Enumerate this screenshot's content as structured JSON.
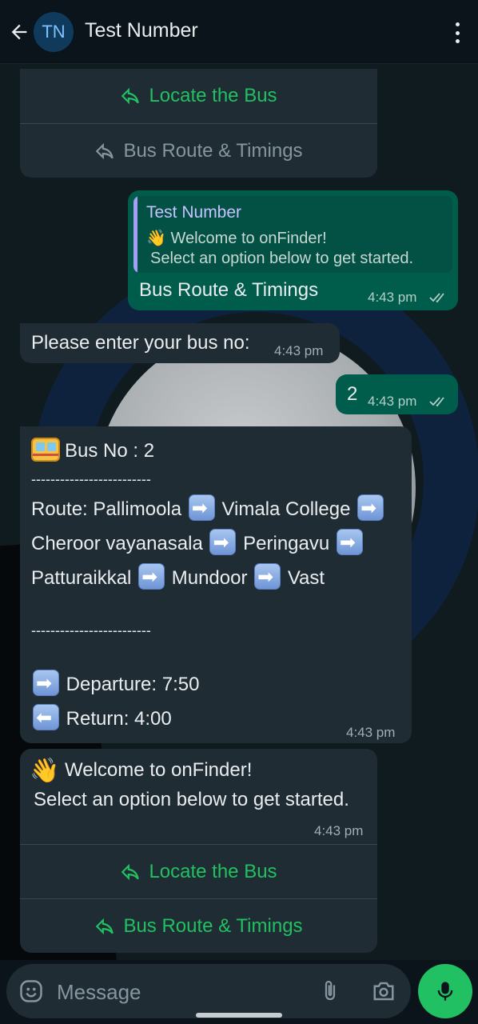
{
  "header": {
    "title": "Test Number",
    "avatar_initials": "TN"
  },
  "top_card": {
    "btn1": "Locate the Bus",
    "btn2": "Bus Route & Timings"
  },
  "reply_out": {
    "quote_author": "Test Number",
    "quote_line1": "👋 Welcome to onFinder!",
    "quote_line2": "Select an option below to get started.",
    "text": "Bus Route & Timings",
    "time": "4:43 pm"
  },
  "msg_prompt": {
    "text": "Please enter your bus no:",
    "time": "4:43 pm"
  },
  "msg_number": {
    "text": "2",
    "time": "4:43 pm"
  },
  "route_msg": {
    "line1": "Bus No : 2",
    "divider": "-------------------------",
    "route_label": "Route: Pallimoola",
    "stop2": "Vimala College",
    "stop3": "Cheroor vayanasala",
    "stop4": "Peringavu",
    "stop5": "Patturaikkal",
    "stop6": "Mundoor",
    "stop7": "Vast",
    "departure": "Departure: 7:50",
    "return": "Return: 4:00",
    "time": "4:43 pm"
  },
  "welcome": {
    "line1": "Welcome to onFinder!",
    "line2": "Select an option below to get started.",
    "time": "4:43 pm",
    "btn1": "Locate the Bus",
    "btn2": "Bus Route & Timings"
  },
  "composer": {
    "placeholder": "Message"
  },
  "colors": {
    "accent": "#21c063",
    "incoming": "#202c33",
    "outgoing": "#005c4b",
    "background": "#0b141a"
  }
}
